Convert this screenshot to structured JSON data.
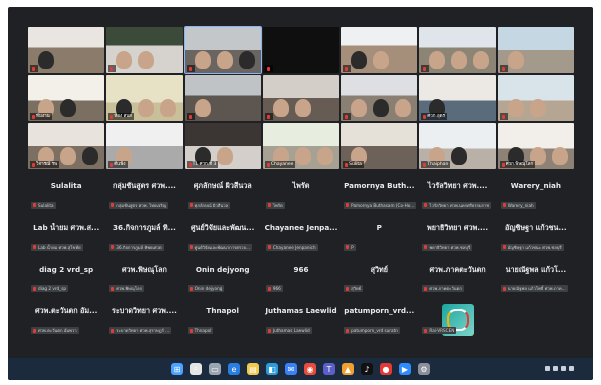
{
  "video_tiles": [
    {
      "label": ""
    },
    {
      "label": ""
    },
    {
      "label": ""
    },
    {
      "label": ""
    },
    {
      "label": ""
    },
    {
      "label": ""
    },
    {
      "label": ""
    },
    {
      "label": "ทีมงาน"
    },
    {
      "label": "ห้อง สบส"
    },
    {
      "label": ""
    },
    {
      "label": ""
    },
    {
      "label": ""
    },
    {
      "label": "ศวก.อุดร"
    },
    {
      "label": ""
    },
    {
      "label": "วิจารณ์ รพ"
    },
    {
      "label": "ดีแฟ้ง"
    },
    {
      "label": "T1 ศวก.ที่ 3"
    },
    {
      "label": "Chayanee"
    },
    {
      "label": "Sulita"
    },
    {
      "label": "Thaiphan"
    },
    {
      "label": "ศวก.พิษณุโลก"
    }
  ],
  "participants": [
    {
      "name": "Sulalita",
      "sub": "Sulalita"
    },
    {
      "name": "กลุ่มชันสูตร ศวพ....",
      "sub": "กลุ่มชันสูตร ศวพ. ไทยเจริญ"
    },
    {
      "name": "ศุภลักษณ์ ผิวสีนวล",
      "sub": "ศุภลักษณ์ ผิวสีนวล"
    },
    {
      "name": "ไพรัต",
      "sub": "ไพรัต"
    },
    {
      "name": "Pamornya Buth...",
      "sub": "Pamornya Buthasam (Co-Ho..."
    },
    {
      "name": "ไวรัลวิทยา ศวพ....",
      "sub": "ไวรัลวิทยา ศวพ.นครศรีธรรมราช"
    },
    {
      "name": "Warery_niah",
      "sub": "Warery_niah"
    },
    {
      "name": "Lab น้ำยม ศวพ.ส...",
      "sub": "Lab น้ำยม ศวพ.สุโขทัย"
    },
    {
      "name": "36.กิจการภูมล์ ทิ...",
      "sub": "36.กิจการภูมล์ ทิพยเศวต"
    },
    {
      "name": "ศูนย์วิจัยและพัฒน...",
      "sub": "ศูนย์วิจัยและพัฒนาการตรวจ..."
    },
    {
      "name": "Chayanee Jenpa...",
      "sub": "Chayanee Jenpanich"
    },
    {
      "name": "P",
      "sub": "P"
    },
    {
      "name": "พยาธิวิทยา ศวพ....",
      "sub": "พยาธิวิทยา ศวพ.ชลบุรี"
    },
    {
      "name": "อัญชิษฐา แก้วชน...",
      "sub": "อัญชิษฐา แก้วชนะ ศวพ.ชลบุรี"
    },
    {
      "name": "diag 2 vrd_sp",
      "sub": "diag 2 vrd_sp"
    },
    {
      "name": "ศวพ.พิษณุโลก",
      "sub": "ศวพ.พิษณุโลก"
    },
    {
      "name": "Onin dejyong",
      "sub": "Onin dejyong"
    },
    {
      "name": "966",
      "sub": "966"
    },
    {
      "name": "สุวิทย์",
      "sub": "สุวิทย์"
    },
    {
      "name": "ศวพ.ภาคตะวันตก",
      "sub": "ศวพ.ภาคตะวันตก"
    },
    {
      "name": "นายณัฐพล แก้วโ...",
      "sub": "นายณัฐพล แก้วโพธิ์ ศวพ.ภาค..."
    },
    {
      "name": "ศวพ.ตะวันตก อัม...",
      "sub": "ศวพ.ตะวันตก อัมพวา"
    },
    {
      "name": "ระบาดวิทยา ศวพ....",
      "sub": "ระบาดวิทยา ศวพ.สุราษฎร์ ..."
    },
    {
      "name": "Thnapol",
      "sub": "Thnapol"
    },
    {
      "name": "Juthamas Laewlid",
      "sub": "Juthamas Laewlid"
    },
    {
      "name": "patumporn_vrd...",
      "sub": "patumporn_vrd suratn"
    },
    {
      "name": "",
      "sub": "Rai-VRSCEN"
    }
  ],
  "taskbar_icons": [
    "windows-icon",
    "search-icon",
    "taskview-icon",
    "edge-icon",
    "explorer-icon",
    "store-icon",
    "mail-icon",
    "chrome-icon",
    "teams-icon",
    "photos-icon",
    "tiktok-icon",
    "media-icon",
    "zoom-icon",
    "settings-icon"
  ],
  "colors": {
    "frame_bg": "#202124",
    "accent": "#8ab4f8",
    "mic_muted": "#e53935",
    "taskbar": "#1b2a3d"
  }
}
